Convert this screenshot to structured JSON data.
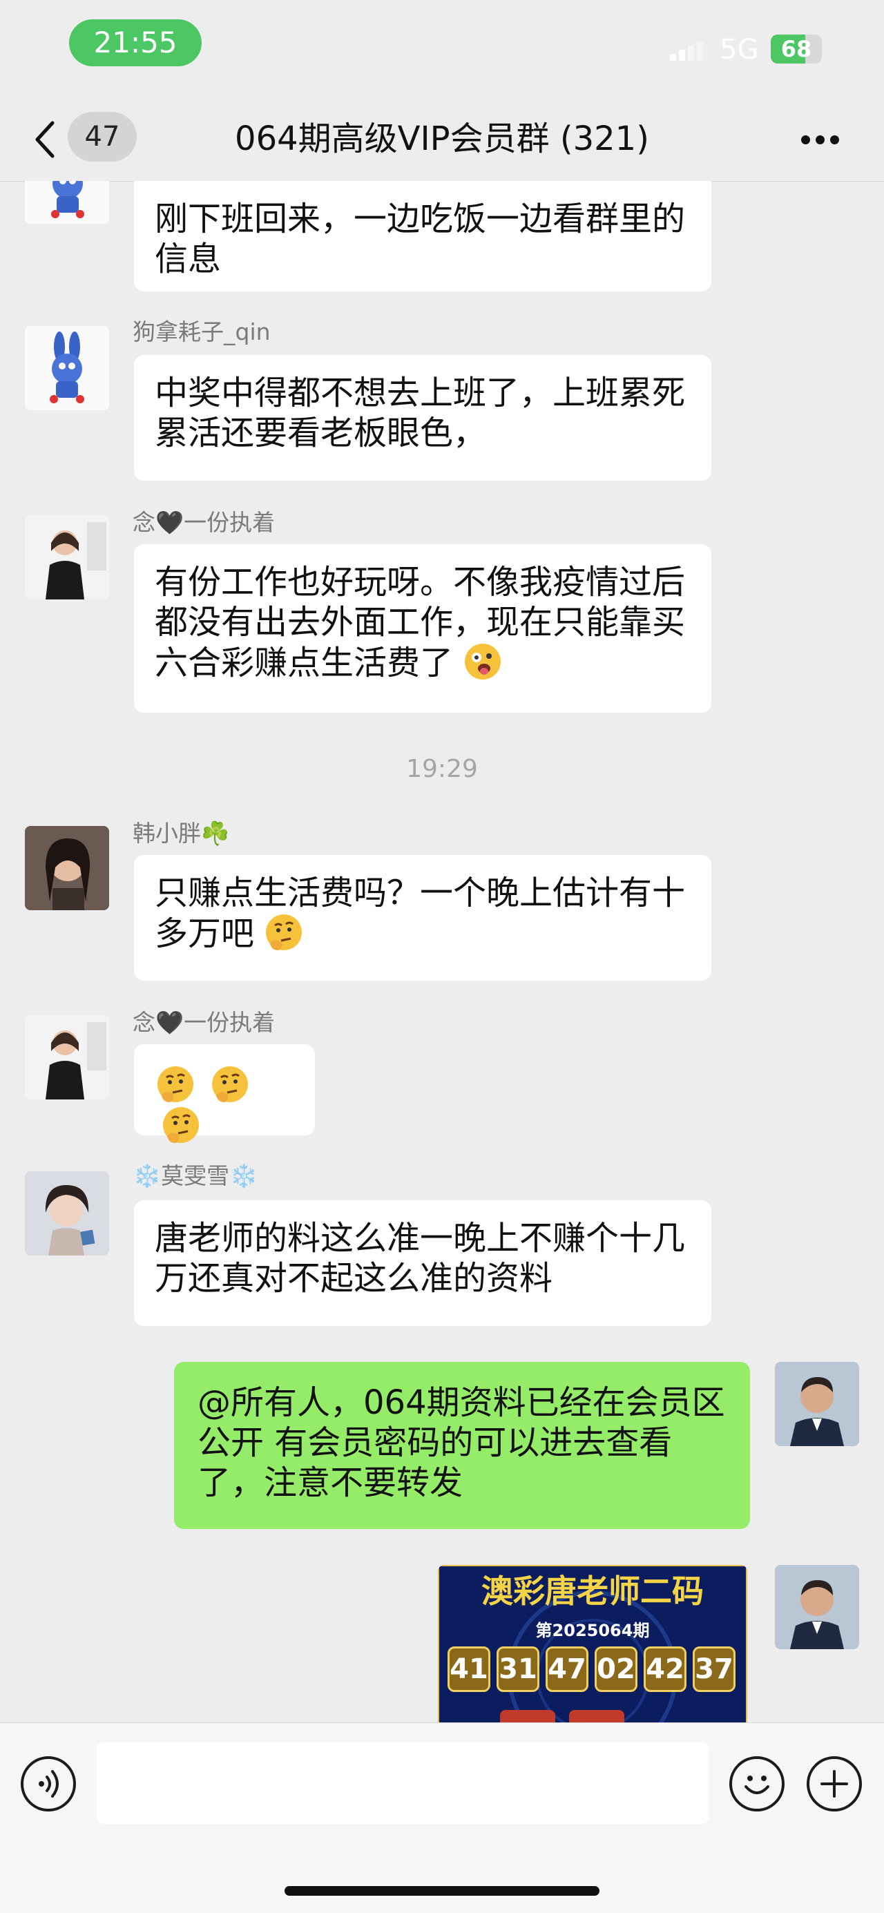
{
  "status_bar": {
    "time": "21:55",
    "network": "5G",
    "battery": "68",
    "battery_level_percent": 68
  },
  "nav": {
    "unread_count": "47",
    "title": "064期高级VIP会员群 (321)"
  },
  "colors": {
    "incoming_bubble": "#ffffff",
    "outgoing_bubble": "#95ec69",
    "background": "#ededed",
    "accent": "#4cc764"
  },
  "messages": [
    {
      "sender": "",
      "text": "刚下班回来，一边吃饭一边看群里的信息",
      "avatar_icon": "bunny-avatar-icon"
    },
    {
      "sender": "狗拿耗子_qin",
      "text": "中奖中得都不想去上班了，上班累死累活还要看老板眼色，",
      "avatar_icon": "bunny-avatar-icon"
    },
    {
      "sender": "念🖤一份执着",
      "text": "有份工作也好玩呀。不像我疫情过后都没有出去外面工作，现在只能靠买六合彩赚点生活费了",
      "emoji": "tongue-out-emoji-icon"
    },
    {
      "time_divider": "19:29"
    },
    {
      "sender": "韩小胖☘️",
      "text": "只赚点生活费吗？一个晚上估计有十多万吧",
      "emoji": "thinking-face-emoji-icon"
    },
    {
      "sender": "念🖤一份执着",
      "text": "",
      "emoji": "thinking-face-emoji-icon x3"
    },
    {
      "sender": "❄️莫雯雪❄️",
      "text": "唐老师的料这么准一晚上不赚个十几万还真对不起这么准的资料"
    },
    {
      "sender": "",
      "text": "@所有人，064期资料已经在会员区公开 有会员密码的可以进去查看了，注意不要转发",
      "outgoing": true
    },
    {
      "outgoing": true,
      "image": {
        "title": "澳彩唐老师二码",
        "issue": "第2025064期",
        "numbers": [
          "41",
          "31",
          "47",
          "02",
          "42",
          "37"
        ]
      }
    }
  ],
  "input": {
    "placeholder": ""
  }
}
